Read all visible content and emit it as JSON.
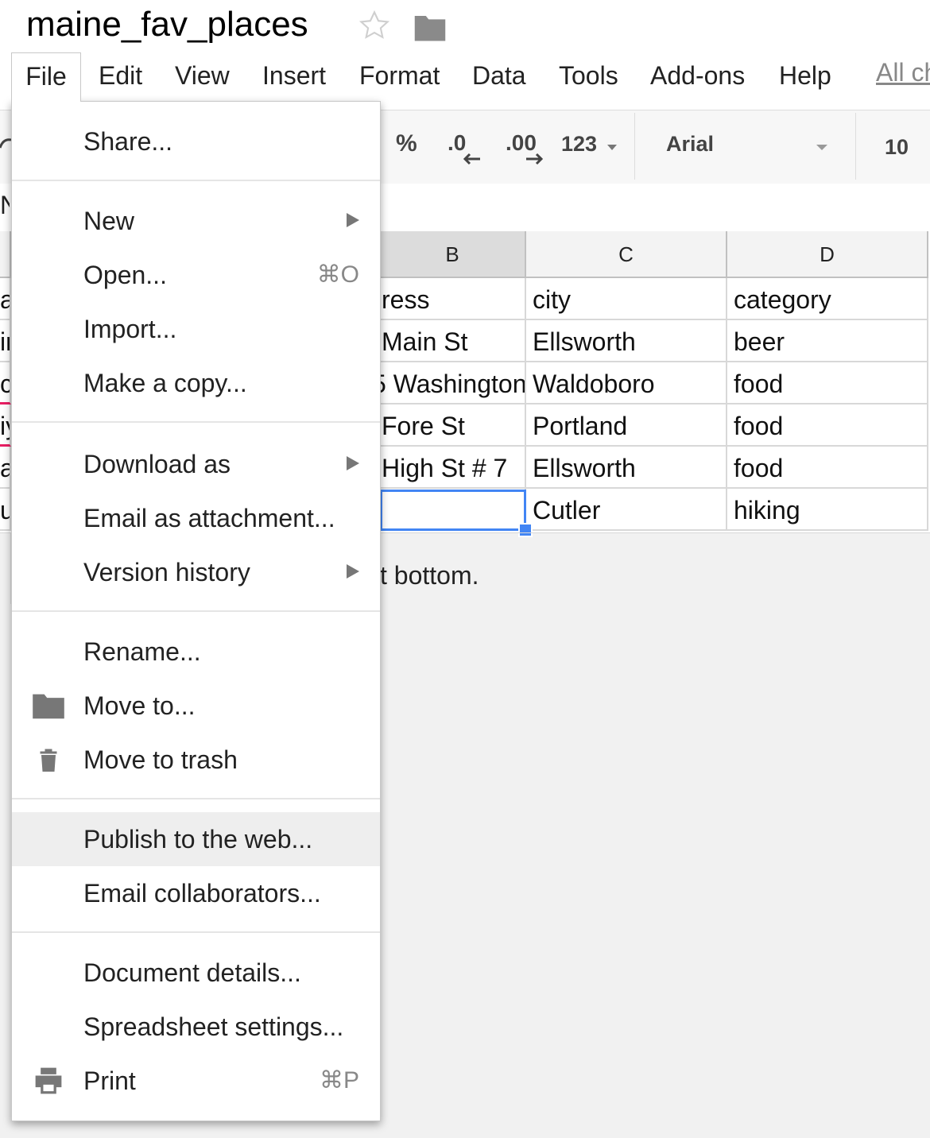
{
  "doc": {
    "title": "maine_fav_places"
  },
  "menu": {
    "items": [
      "File",
      "Edit",
      "View",
      "Insert",
      "Format",
      "Data",
      "Tools",
      "Add-ons",
      "Help"
    ],
    "all_changes": "All ch"
  },
  "toolbar": {
    "percent": "%",
    "decrease_decimal": ".0",
    "increase_decimal": ".00",
    "more_formats": "123",
    "font": "Arial",
    "font_size": "10"
  },
  "sheet": {
    "columns": [
      "B",
      "C",
      "D"
    ],
    "rows": [
      [
        "ress",
        "city",
        "category"
      ],
      [
        "Main St",
        "Ellsworth",
        "beer"
      ],
      [
        "5 Washington",
        "Waldoboro",
        "food"
      ],
      [
        "Fore St",
        "Portland",
        "food"
      ],
      [
        "High St # 7",
        "Ellsworth",
        "food"
      ],
      [
        "",
        "Cutler",
        "hiking"
      ]
    ],
    "left_fragments": [
      "a",
      "ir",
      "c",
      "iy",
      "a",
      "u"
    ],
    "formula_fragment": "N",
    "below_text": "t bottom."
  },
  "file_menu": {
    "share": "Share...",
    "new": "New",
    "open": "Open...",
    "open_shortcut": "⌘O",
    "import": "Import...",
    "make_copy": "Make a copy...",
    "download_as": "Download as",
    "email_attachment": "Email as attachment...",
    "version_history": "Version history",
    "rename": "Rename...",
    "move_to": "Move to...",
    "move_to_trash": "Move to trash",
    "publish": "Publish to the web...",
    "email_collaborators": "Email collaborators...",
    "document_details": "Document details...",
    "spreadsheet_settings": "Spreadsheet settings...",
    "print": "Print",
    "print_shortcut": "⌘P"
  },
  "colors": {
    "accent": "#4285f4",
    "hover": "#eeeeee",
    "error_underline": "#e91e63"
  }
}
